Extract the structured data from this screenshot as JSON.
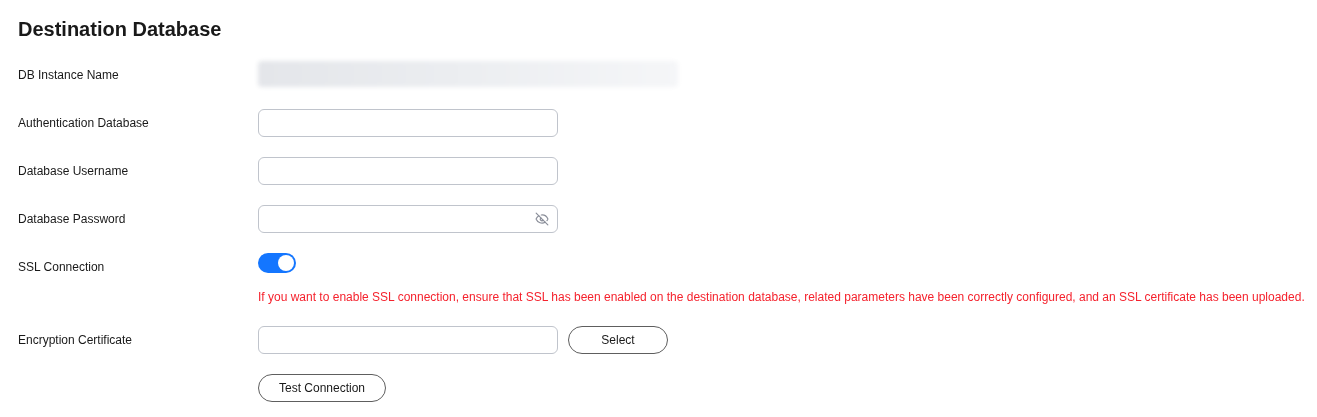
{
  "title": "Destination Database",
  "fields": [
    {
      "kind": "redacted",
      "label": "DB Instance Name"
    },
    {
      "kind": "text",
      "label": "Authentication Database"
    },
    {
      "kind": "text",
      "label": "Database Username"
    },
    {
      "kind": "password",
      "label": "Database Password"
    },
    {
      "kind": "switch",
      "label": "SSL Connection",
      "on": true,
      "note": "If you want to enable SSL connection, ensure that SSL has been enabled on the destination database, related parameters have been correctly configured, and an SSL certificate has been uploaded."
    },
    {
      "kind": "file",
      "label": "Encryption Certificate",
      "button": "Select"
    }
  ],
  "test_button": "Test Connection"
}
